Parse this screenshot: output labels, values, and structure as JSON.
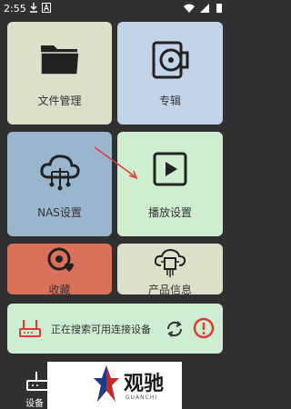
{
  "status_bar": {
    "time": "2:55"
  },
  "tiles": [
    {
      "label": "文件管理",
      "color": "#dedfc9",
      "icon": "folder-icon"
    },
    {
      "label": "专辑",
      "color": "#c3d4e8",
      "icon": "album-icon"
    },
    {
      "label": "NAS设置",
      "color": "#9ab6ce",
      "icon": "cloud-network-icon"
    },
    {
      "label": "播放设置",
      "color": "#cfeed0",
      "icon": "play-icon"
    },
    {
      "label": "收藏",
      "color": "#d9705a",
      "icon": "favorite-icon"
    },
    {
      "label": "产品信息",
      "color": "#dedfc9",
      "icon": "chip-cloud-icon"
    }
  ],
  "search": {
    "text": "正在搜索可用连接设备",
    "color": "#cdeed2",
    "icons": [
      "router-icon",
      "refresh-icon",
      "alert-icon"
    ]
  },
  "bottom_nav": {
    "device_label": "设备"
  },
  "watermark": {
    "title": "观驰",
    "subtitle": "GUANCHI"
  }
}
